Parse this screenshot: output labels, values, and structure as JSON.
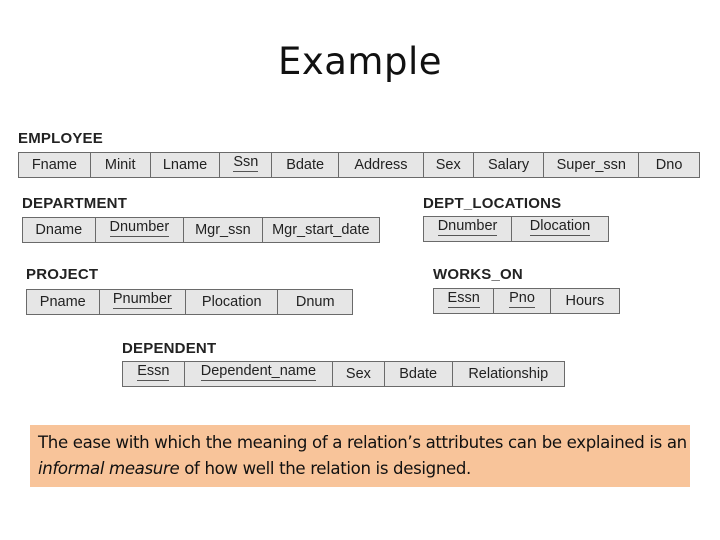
{
  "title": "Example",
  "relations": {
    "employee": {
      "name": "EMPLOYEE",
      "attributes": [
        {
          "label": "Fname",
          "key": false
        },
        {
          "label": "Minit",
          "key": false
        },
        {
          "label": "Lname",
          "key": false
        },
        {
          "label": "Ssn",
          "key": true
        },
        {
          "label": "Bdate",
          "key": false
        },
        {
          "label": "Address",
          "key": false
        },
        {
          "label": "Sex",
          "key": false
        },
        {
          "label": "Salary",
          "key": false
        },
        {
          "label": "Super_ssn",
          "key": false
        },
        {
          "label": "Dno",
          "key": false
        }
      ]
    },
    "department": {
      "name": "DEPARTMENT",
      "attributes": [
        {
          "label": "Dname",
          "key": false
        },
        {
          "label": "Dnumber",
          "key": true
        },
        {
          "label": "Mgr_ssn",
          "key": false
        },
        {
          "label": "Mgr_start_date",
          "key": false
        }
      ]
    },
    "dept_locations": {
      "name": "DEPT_LOCATIONS",
      "attributes": [
        {
          "label": "Dnumber",
          "key": true
        },
        {
          "label": "Dlocation",
          "key": true
        }
      ]
    },
    "project": {
      "name": "PROJECT",
      "attributes": [
        {
          "label": "Pname",
          "key": false
        },
        {
          "label": "Pnumber",
          "key": true
        },
        {
          "label": "Plocation",
          "key": false
        },
        {
          "label": "Dnum",
          "key": false
        }
      ]
    },
    "works_on": {
      "name": "WORKS_ON",
      "attributes": [
        {
          "label": "Essn",
          "key": true
        },
        {
          "label": "Pno",
          "key": true
        },
        {
          "label": "Hours",
          "key": false
        }
      ]
    },
    "dependent": {
      "name": "DEPENDENT",
      "attributes": [
        {
          "label": "Essn",
          "key": true
        },
        {
          "label": "Dependent_name",
          "key": true
        },
        {
          "label": "Sex",
          "key": false
        },
        {
          "label": "Bdate",
          "key": false
        },
        {
          "label": "Relationship",
          "key": false
        }
      ]
    }
  },
  "note": {
    "text_before": "The ease with which the meaning of a relation’s attributes can be explained is an ",
    "emphasis": "informal measure",
    "text_after": " of how well the relation is designed.",
    "background_color": "#f8c49a"
  }
}
